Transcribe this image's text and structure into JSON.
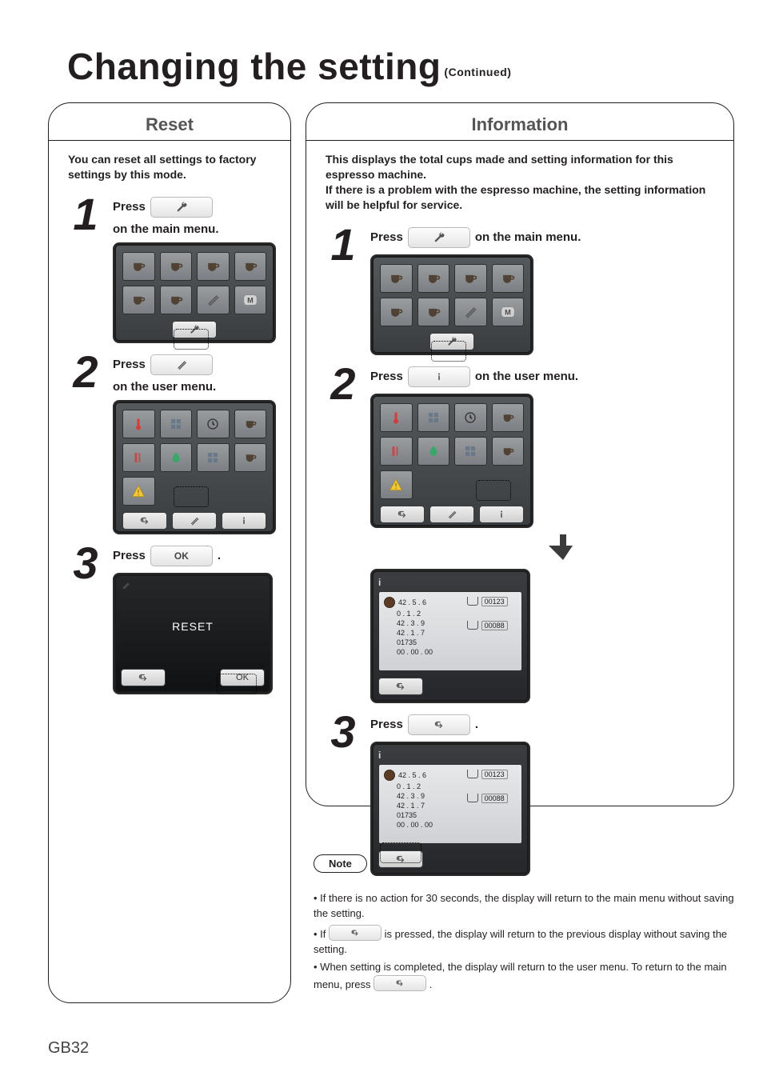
{
  "title": "Changing the setting",
  "title_suffix": "(Continued)",
  "page_number": "GB32",
  "left": {
    "heading": "Reset",
    "intro": "You can reset all settings to factory settings by this mode.",
    "steps": {
      "s1": {
        "num": "1",
        "pre": "Press",
        "post": "on the main menu."
      },
      "s2": {
        "num": "2",
        "pre": "Press",
        "post": "on the user menu."
      },
      "s3": {
        "num": "3",
        "pre": "Press",
        "btn": "OK",
        "post": "."
      }
    },
    "reset_label": "RESET",
    "ok_label": "OK"
  },
  "right": {
    "heading": "Information",
    "intro": "This displays the total cups made and setting information for this espresso machine.\nIf there is a problem with the espresso machine, the setting information will be helpful for service.",
    "steps": {
      "s1": {
        "num": "1",
        "pre": "Press",
        "post": "on the main menu."
      },
      "s2": {
        "num": "2",
        "pre": "Press",
        "post": "on the user menu."
      },
      "s3": {
        "num": "3",
        "pre": "Press",
        "post": "."
      }
    },
    "info_values": {
      "left_col": [
        "42 . 5 . 6",
        "0 . 1 . 2",
        "42 . 3 . 9",
        "42 . 1 . 7",
        "01735",
        "00 . 00 . 00"
      ],
      "count1": "00123",
      "count2": "00088"
    }
  },
  "note": {
    "label": "Note",
    "n1a": "If there is no action for 30 seconds, the display will return to the main menu without saving the setting.",
    "n2a": "If",
    "n2b": "is pressed, the display will return to the previous display without saving the setting.",
    "n3a": "When setting is completed, the display will return to the user menu. To return to the main menu, press",
    "n3b": "."
  }
}
